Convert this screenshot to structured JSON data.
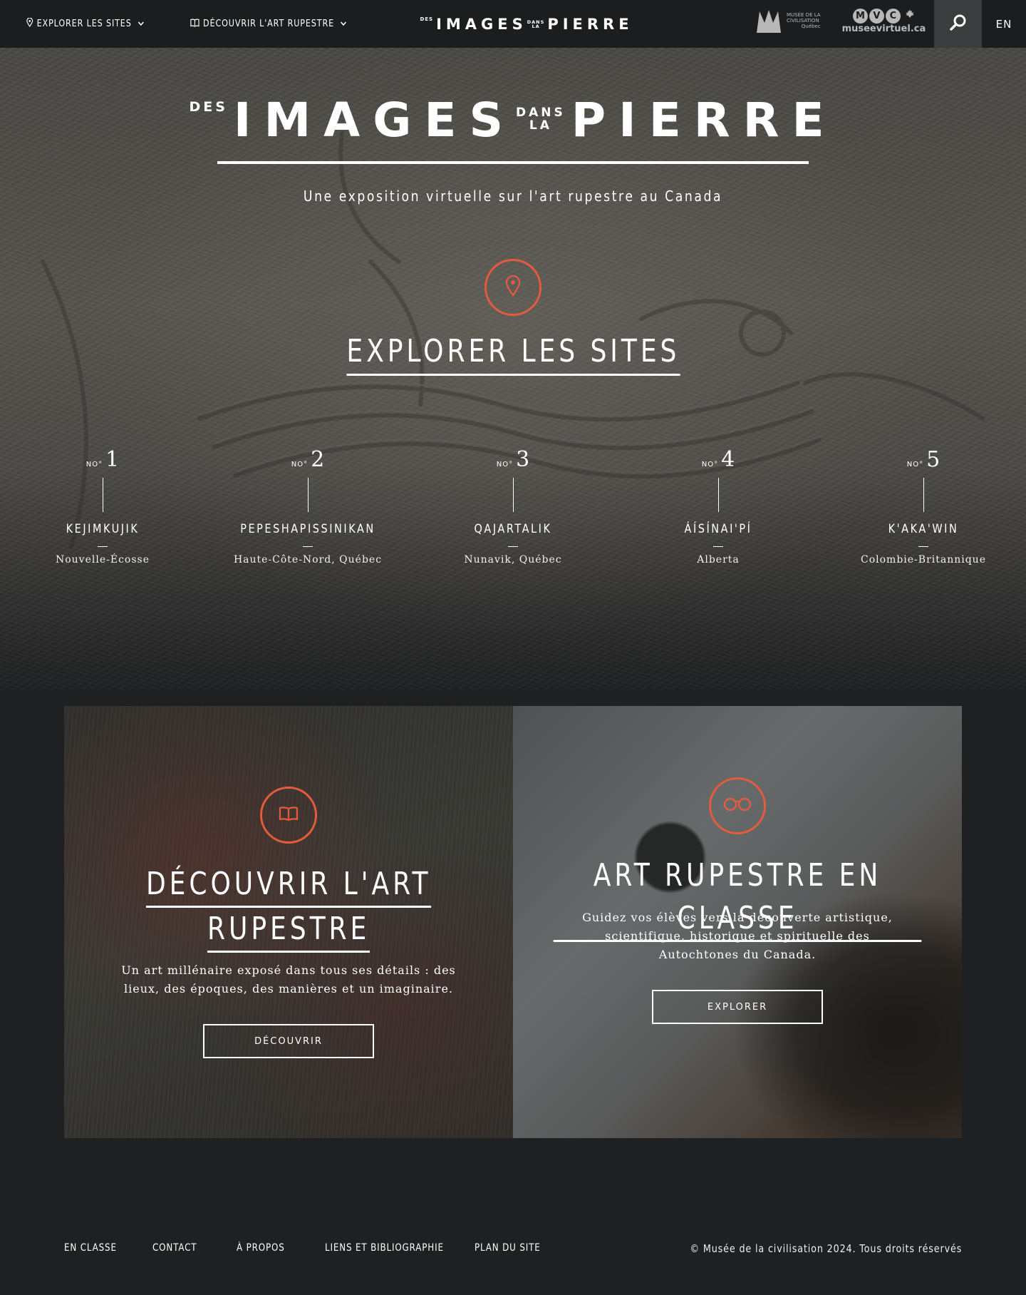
{
  "header": {
    "nav": [
      {
        "label": "EXPLORER LES SITES",
        "icon": "map-pin-icon"
      },
      {
        "label": "DÉCOUVRIR L'ART RUPESTRE",
        "icon": "book-icon"
      }
    ],
    "logo": {
      "small1": "DES",
      "big1": "IMAGES",
      "small2a": "DANS",
      "small2b": "LA",
      "big2": "PIERRE"
    },
    "partner_mcq": {
      "line1": "MUSÉE DE LA",
      "line2": "CIVILISATION",
      "line3": "Québec"
    },
    "partner_mvc": {
      "letters": [
        "M",
        "V",
        "C"
      ],
      "domain": "museevirtuel.ca"
    },
    "search_icon": "search-icon",
    "lang": "EN"
  },
  "hero": {
    "title": {
      "small1": "DES",
      "big1": "IMAGES",
      "small2a": "DANS",
      "small2b": "LA",
      "big2": "PIERRE"
    },
    "subtitle": "Une exposition virtuelle sur l'art rupestre au Canada",
    "icon": "map-pin-icon",
    "explore_label": "EXPLORER LES SITES",
    "number_prefix": "NO°",
    "sites": [
      {
        "number": "1",
        "name": "KEJIMKUJIK",
        "region": "Nouvelle-Écosse"
      },
      {
        "number": "2",
        "name": "PEPESHAPISSINIKAN",
        "region": "Haute-Côte-Nord, Québec"
      },
      {
        "number": "3",
        "name": "QAJARTALIK",
        "region": "Nunavik, Québec"
      },
      {
        "number": "4",
        "name": "ÁÍSÍNAI'PÍ",
        "region": "Alberta"
      },
      {
        "number": "5",
        "name": "K'AKA'WIN",
        "region": "Colombie-Britannique"
      }
    ]
  },
  "cards": [
    {
      "icon": "open-book-icon",
      "title_lines": [
        "DÉCOUVRIR L'ART",
        "RUPESTRE"
      ],
      "text": "Un art millénaire exposé dans tous ses détails : des lieux, des époques, des manières et un imaginaire.",
      "button": "DÉCOUVRIR"
    },
    {
      "icon": "binoculars-icon",
      "title_lines": [
        "ART RUPESTRE EN CLASSE"
      ],
      "text": "Guidez vos élèves vers la découverte artistique, scientifique, historique et spirituelle des Autochtones du Canada.",
      "button": "EXPLORER"
    }
  ],
  "footer": {
    "links": [
      "EN CLASSE",
      "CONTACT",
      "À PROPOS",
      "LIENS ET BIBLIOGRAPHIE",
      "PLAN DU SITE"
    ],
    "copyright": "© Musée de la civilisation 2024. Tous droits réservés"
  },
  "colors": {
    "accent": "#e45b3e",
    "background": "#1f2021",
    "header": "#1c1d1e",
    "search_bg": "#3b3c3d"
  }
}
